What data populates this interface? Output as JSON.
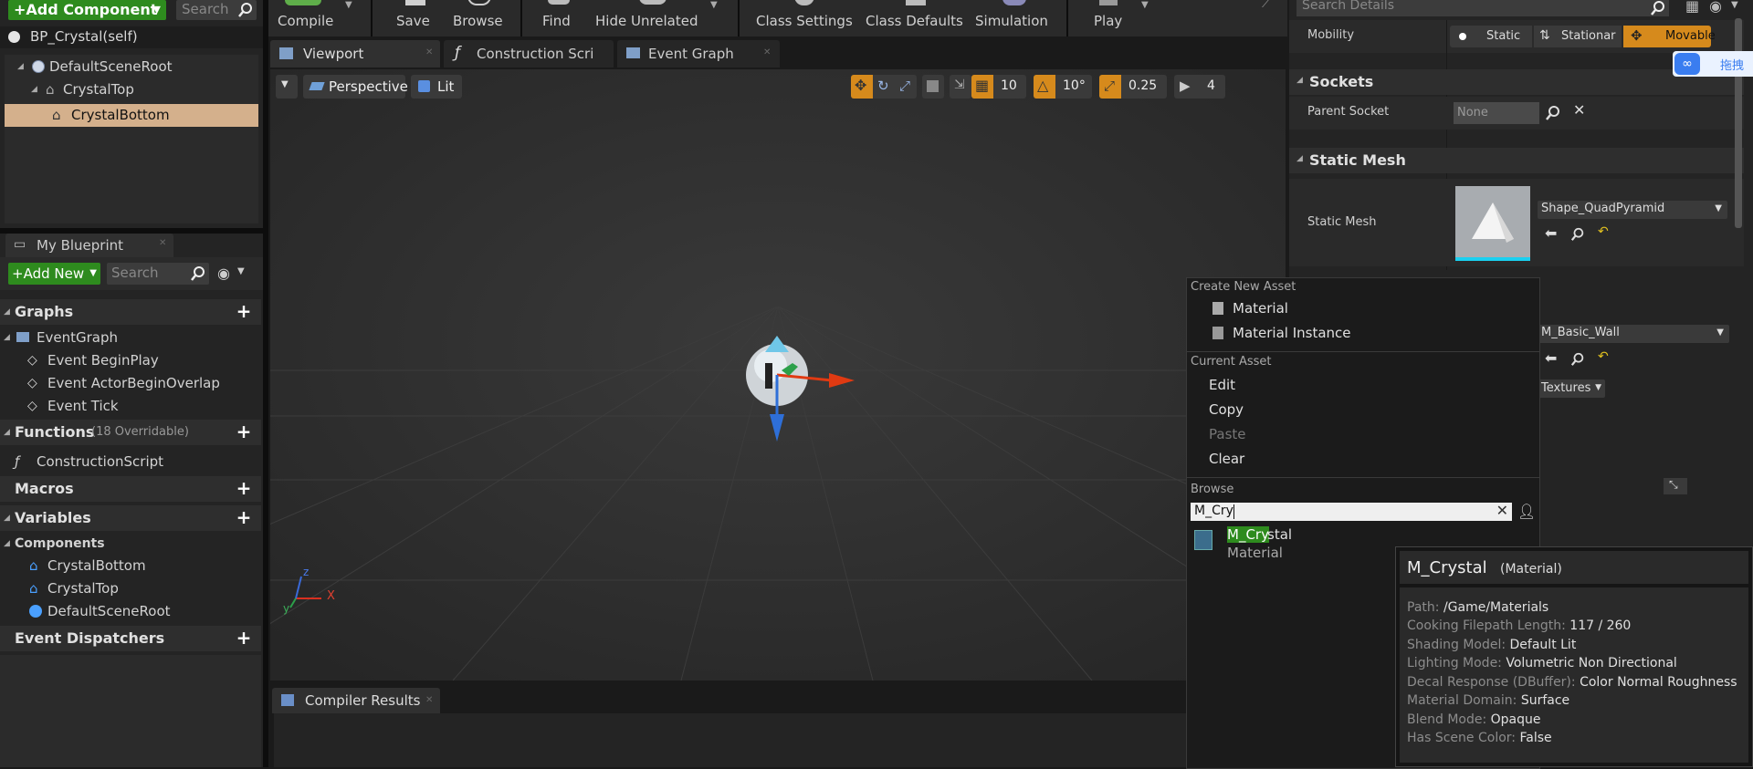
{
  "colors": {
    "accent": "#d68a1c",
    "selection": "#d4b08c",
    "green_btn": "#2e8b1e"
  },
  "components": {
    "add_component_label": "+Add Component",
    "search_placeholder": "Search",
    "self_item": "BP_Crystal(self)",
    "tree": [
      {
        "label": "DefaultSceneRoot",
        "icon": "scene-root-icon"
      },
      {
        "label": "CrystalTop",
        "icon": "static-mesh-icon"
      },
      {
        "label": "CrystalBottom",
        "icon": "static-mesh-icon"
      }
    ]
  },
  "toolbar": {
    "items": [
      "Compile",
      "Save",
      "Browse",
      "Find",
      "Hide Unrelated",
      "Class Settings",
      "Class Defaults",
      "Simulation",
      "Play"
    ]
  },
  "tabs": [
    {
      "label": "Viewport",
      "icon": "viewport-icon"
    },
    {
      "label": "Construction Scrip",
      "icon": "function-icon"
    },
    {
      "label": "Event Graph",
      "icon": "graph-icon"
    }
  ],
  "viewport": {
    "perspective": "Perspective",
    "lit": "Lit",
    "grid_snap": "10",
    "rot_snap": "10°",
    "scale_snap": "0.25",
    "camera_speed": "4",
    "axis_y": "y",
    "axis_x": "X",
    "axis_z": "z"
  },
  "my_blueprint": {
    "tab_label": "My Blueprint",
    "add_new_label": "+Add New",
    "search_placeholder": "Search",
    "graphs_header": "Graphs",
    "event_graph": "EventGraph",
    "events": [
      "Event BeginPlay",
      "Event ActorBeginOverlap",
      "Event Tick"
    ],
    "functions_header": "Functions",
    "functions_count": "(18 Overridable)",
    "construction_script": "ConstructionScript",
    "macros_header": "Macros",
    "variables_header": "Variables",
    "components_sub": "Components",
    "variable_components": [
      "CrystalBottom",
      "CrystalTop",
      "DefaultSceneRoot"
    ],
    "dispatchers_header": "Event Dispatchers"
  },
  "compiler": {
    "tab_label": "Compiler Results"
  },
  "details": {
    "search_placeholder": "Search Details",
    "mobility_label": "Mobility",
    "mobility_options": [
      "Static",
      "Stationar",
      "Movable"
    ],
    "sockets_header": "Sockets",
    "parent_socket_label": "Parent Socket",
    "parent_socket_value": "None",
    "static_mesh_header": "Static Mesh",
    "static_mesh_label": "Static Mesh",
    "static_mesh_value": "Shape_QuadPyramid",
    "material_value": "M_Basic_Wall",
    "textures_label": "Textures"
  },
  "context_menu": {
    "create_header": "Create New Asset",
    "create_items": [
      "Material",
      "Material Instance"
    ],
    "current_header": "Current Asset",
    "current_items": [
      "Edit",
      "Copy",
      "Paste",
      "Clear"
    ],
    "browse_header": "Browse",
    "search_value": "M_Cry",
    "result_name_match": "M_Cry",
    "result_name_rest": "stal",
    "result_type": "Material"
  },
  "tooltip": {
    "title": "M_Crystal",
    "title_type": "(Material)",
    "rows": [
      {
        "k": "Path:",
        "v": "/Game/Materials"
      },
      {
        "k": "Cooking Filepath Length:",
        "v": "117 / 260"
      },
      {
        "k": "Shading Model:",
        "v": "Default Lit"
      },
      {
        "k": "Lighting Mode:",
        "v": "Volumetric Non Directional"
      },
      {
        "k": "Decal Response (DBuffer):",
        "v": "Color Normal Roughness"
      },
      {
        "k": "Material Domain:",
        "v": "Surface"
      },
      {
        "k": "Blend Mode:",
        "v": "Opaque"
      },
      {
        "k": "Has Scene Color:",
        "v": "False"
      }
    ]
  },
  "corner_widget": {
    "label": "拖拽"
  }
}
